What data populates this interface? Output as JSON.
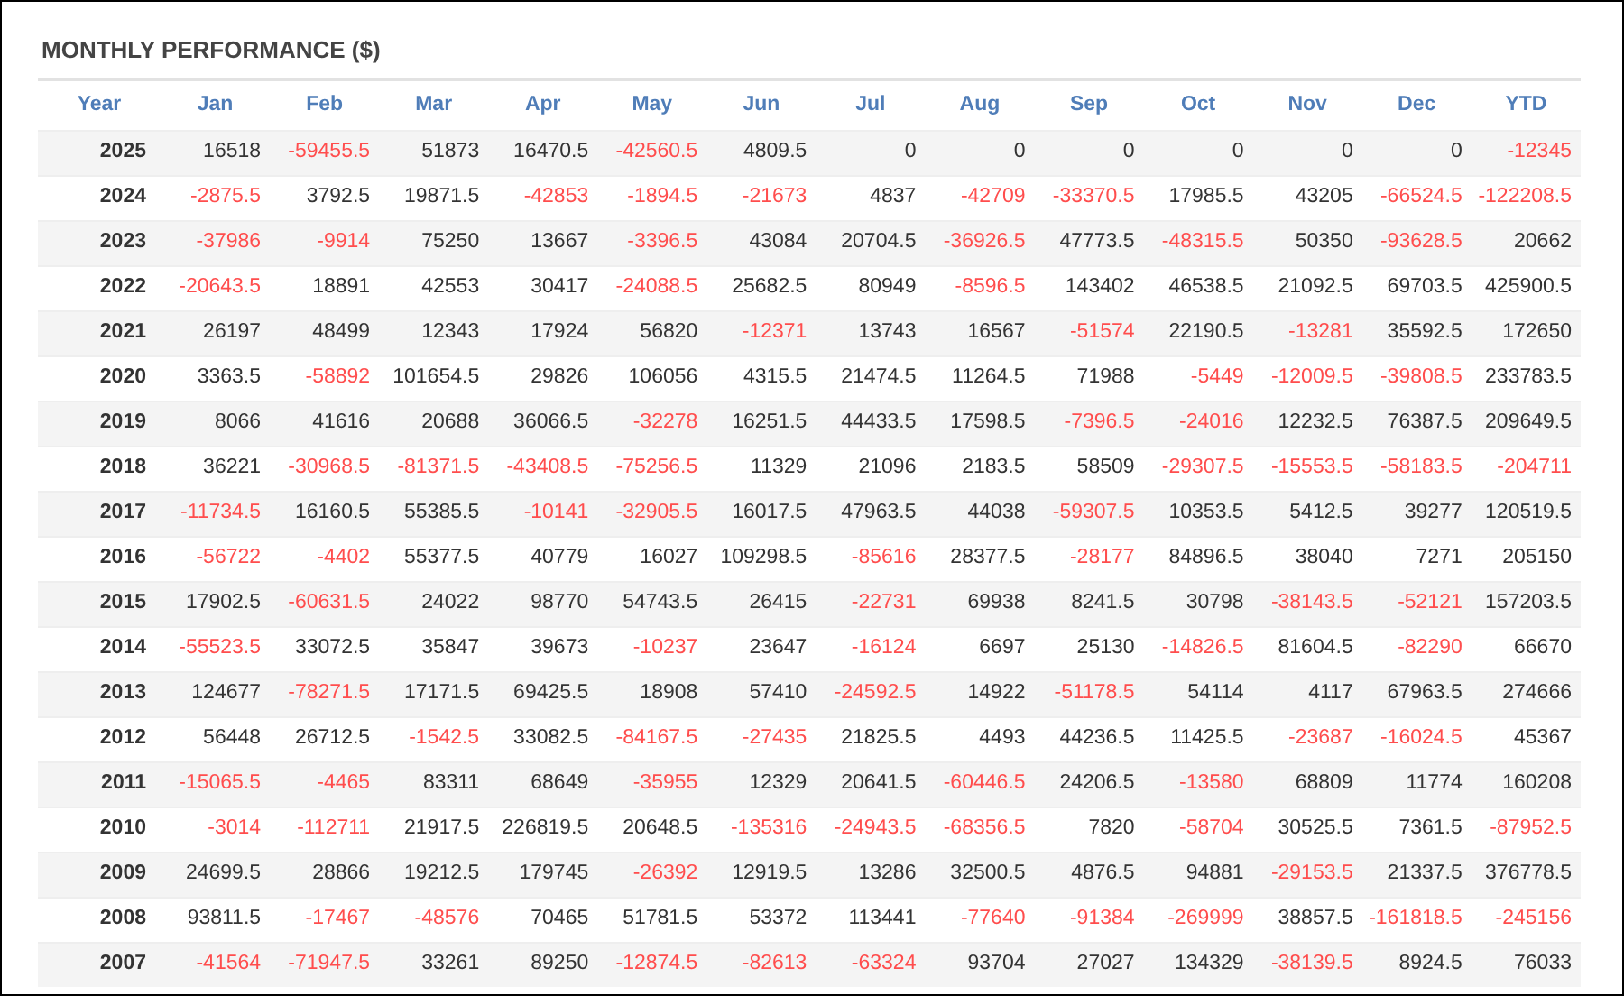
{
  "title": "MONTHLY PERFORMANCE ($)",
  "table": {
    "columns": [
      "Year",
      "Jan",
      "Feb",
      "Mar",
      "Apr",
      "May",
      "Jun",
      "Jul",
      "Aug",
      "Sep",
      "Oct",
      "Nov",
      "Dec",
      "YTD"
    ],
    "rows": [
      {
        "cells": [
          {
            "value": "2025",
            "negative": false
          },
          {
            "value": "16518",
            "negative": false
          },
          {
            "value": "-59455.5",
            "negative": true
          },
          {
            "value": "51873",
            "negative": false
          },
          {
            "value": "16470.5",
            "negative": false
          },
          {
            "value": "-42560.5",
            "negative": true
          },
          {
            "value": "4809.5",
            "negative": false
          },
          {
            "value": "0",
            "negative": false
          },
          {
            "value": "0",
            "negative": false
          },
          {
            "value": "0",
            "negative": false
          },
          {
            "value": "0",
            "negative": false
          },
          {
            "value": "0",
            "negative": false
          },
          {
            "value": "0",
            "negative": false
          },
          {
            "value": "-12345",
            "negative": true
          }
        ]
      },
      {
        "cells": [
          {
            "value": "2024",
            "negative": false
          },
          {
            "value": "-2875.5",
            "negative": true
          },
          {
            "value": "3792.5",
            "negative": false
          },
          {
            "value": "19871.5",
            "negative": false
          },
          {
            "value": "-42853",
            "negative": true
          },
          {
            "value": "-1894.5",
            "negative": true
          },
          {
            "value": "-21673",
            "negative": true
          },
          {
            "value": "4837",
            "negative": false
          },
          {
            "value": "-42709",
            "negative": true
          },
          {
            "value": "-33370.5",
            "negative": true
          },
          {
            "value": "17985.5",
            "negative": false
          },
          {
            "value": "43205",
            "negative": false
          },
          {
            "value": "-66524.5",
            "negative": true
          },
          {
            "value": "-122208.5",
            "negative": true
          }
        ]
      },
      {
        "cells": [
          {
            "value": "2023",
            "negative": false
          },
          {
            "value": "-37986",
            "negative": true
          },
          {
            "value": "-9914",
            "negative": true
          },
          {
            "value": "75250",
            "negative": false
          },
          {
            "value": "13667",
            "negative": false
          },
          {
            "value": "-3396.5",
            "negative": true
          },
          {
            "value": "43084",
            "negative": false
          },
          {
            "value": "20704.5",
            "negative": false
          },
          {
            "value": "-36926.5",
            "negative": true
          },
          {
            "value": "47773.5",
            "negative": false
          },
          {
            "value": "-48315.5",
            "negative": true
          },
          {
            "value": "50350",
            "negative": false
          },
          {
            "value": "-93628.5",
            "negative": true
          },
          {
            "value": "20662",
            "negative": false
          }
        ]
      },
      {
        "cells": [
          {
            "value": "2022",
            "negative": false
          },
          {
            "value": "-20643.5",
            "negative": true
          },
          {
            "value": "18891",
            "negative": false
          },
          {
            "value": "42553",
            "negative": false
          },
          {
            "value": "30417",
            "negative": false
          },
          {
            "value": "-24088.5",
            "negative": true
          },
          {
            "value": "25682.5",
            "negative": false
          },
          {
            "value": "80949",
            "negative": false
          },
          {
            "value": "-8596.5",
            "negative": true
          },
          {
            "value": "143402",
            "negative": false
          },
          {
            "value": "46538.5",
            "negative": false
          },
          {
            "value": "21092.5",
            "negative": false
          },
          {
            "value": "69703.5",
            "negative": false
          },
          {
            "value": "425900.5",
            "negative": false
          }
        ]
      },
      {
        "cells": [
          {
            "value": "2021",
            "negative": false
          },
          {
            "value": "26197",
            "negative": false
          },
          {
            "value": "48499",
            "negative": false
          },
          {
            "value": "12343",
            "negative": false
          },
          {
            "value": "17924",
            "negative": false
          },
          {
            "value": "56820",
            "negative": false
          },
          {
            "value": "-12371",
            "negative": true
          },
          {
            "value": "13743",
            "negative": false
          },
          {
            "value": "16567",
            "negative": false
          },
          {
            "value": "-51574",
            "negative": true
          },
          {
            "value": "22190.5",
            "negative": false
          },
          {
            "value": "-13281",
            "negative": true
          },
          {
            "value": "35592.5",
            "negative": false
          },
          {
            "value": "172650",
            "negative": false
          }
        ]
      },
      {
        "cells": [
          {
            "value": "2020",
            "negative": false
          },
          {
            "value": "3363.5",
            "negative": false
          },
          {
            "value": "-58892",
            "negative": true
          },
          {
            "value": "101654.5",
            "negative": false
          },
          {
            "value": "29826",
            "negative": false
          },
          {
            "value": "106056",
            "negative": false
          },
          {
            "value": "4315.5",
            "negative": false
          },
          {
            "value": "21474.5",
            "negative": false
          },
          {
            "value": "11264.5",
            "negative": false
          },
          {
            "value": "71988",
            "negative": false
          },
          {
            "value": "-5449",
            "negative": true
          },
          {
            "value": "-12009.5",
            "negative": true
          },
          {
            "value": "-39808.5",
            "negative": true
          },
          {
            "value": "233783.5",
            "negative": false
          }
        ]
      },
      {
        "cells": [
          {
            "value": "2019",
            "negative": false
          },
          {
            "value": "8066",
            "negative": false
          },
          {
            "value": "41616",
            "negative": false
          },
          {
            "value": "20688",
            "negative": false
          },
          {
            "value": "36066.5",
            "negative": false
          },
          {
            "value": "-32278",
            "negative": true
          },
          {
            "value": "16251.5",
            "negative": false
          },
          {
            "value": "44433.5",
            "negative": false
          },
          {
            "value": "17598.5",
            "negative": false
          },
          {
            "value": "-7396.5",
            "negative": true
          },
          {
            "value": "-24016",
            "negative": true
          },
          {
            "value": "12232.5",
            "negative": false
          },
          {
            "value": "76387.5",
            "negative": false
          },
          {
            "value": "209649.5",
            "negative": false
          }
        ]
      },
      {
        "cells": [
          {
            "value": "2018",
            "negative": false
          },
          {
            "value": "36221",
            "negative": false
          },
          {
            "value": "-30968.5",
            "negative": true
          },
          {
            "value": "-81371.5",
            "negative": true
          },
          {
            "value": "-43408.5",
            "negative": true
          },
          {
            "value": "-75256.5",
            "negative": true
          },
          {
            "value": "11329",
            "negative": false
          },
          {
            "value": "21096",
            "negative": false
          },
          {
            "value": "2183.5",
            "negative": false
          },
          {
            "value": "58509",
            "negative": false
          },
          {
            "value": "-29307.5",
            "negative": true
          },
          {
            "value": "-15553.5",
            "negative": true
          },
          {
            "value": "-58183.5",
            "negative": true
          },
          {
            "value": "-204711",
            "negative": true
          }
        ]
      },
      {
        "cells": [
          {
            "value": "2017",
            "negative": false
          },
          {
            "value": "-11734.5",
            "negative": true
          },
          {
            "value": "16160.5",
            "negative": false
          },
          {
            "value": "55385.5",
            "negative": false
          },
          {
            "value": "-10141",
            "negative": true
          },
          {
            "value": "-32905.5",
            "negative": true
          },
          {
            "value": "16017.5",
            "negative": false
          },
          {
            "value": "47963.5",
            "negative": false
          },
          {
            "value": "44038",
            "negative": false
          },
          {
            "value": "-59307.5",
            "negative": true
          },
          {
            "value": "10353.5",
            "negative": false
          },
          {
            "value": "5412.5",
            "negative": false
          },
          {
            "value": "39277",
            "negative": false
          },
          {
            "value": "120519.5",
            "negative": false
          }
        ]
      },
      {
        "cells": [
          {
            "value": "2016",
            "negative": false
          },
          {
            "value": "-56722",
            "negative": true
          },
          {
            "value": "-4402",
            "negative": true
          },
          {
            "value": "55377.5",
            "negative": false
          },
          {
            "value": "40779",
            "negative": false
          },
          {
            "value": "16027",
            "negative": false
          },
          {
            "value": "109298.5",
            "negative": false
          },
          {
            "value": "-85616",
            "negative": true
          },
          {
            "value": "28377.5",
            "negative": false
          },
          {
            "value": "-28177",
            "negative": true
          },
          {
            "value": "84896.5",
            "negative": false
          },
          {
            "value": "38040",
            "negative": false
          },
          {
            "value": "7271",
            "negative": false
          },
          {
            "value": "205150",
            "negative": false
          }
        ]
      },
      {
        "cells": [
          {
            "value": "2015",
            "negative": false
          },
          {
            "value": "17902.5",
            "negative": false
          },
          {
            "value": "-60631.5",
            "negative": true
          },
          {
            "value": "24022",
            "negative": false
          },
          {
            "value": "98770",
            "negative": false
          },
          {
            "value": "54743.5",
            "negative": false
          },
          {
            "value": "26415",
            "negative": false
          },
          {
            "value": "-22731",
            "negative": true
          },
          {
            "value": "69938",
            "negative": false
          },
          {
            "value": "8241.5",
            "negative": false
          },
          {
            "value": "30798",
            "negative": false
          },
          {
            "value": "-38143.5",
            "negative": true
          },
          {
            "value": "-52121",
            "negative": true
          },
          {
            "value": "157203.5",
            "negative": false
          }
        ]
      },
      {
        "cells": [
          {
            "value": "2014",
            "negative": false
          },
          {
            "value": "-55523.5",
            "negative": true
          },
          {
            "value": "33072.5",
            "negative": false
          },
          {
            "value": "35847",
            "negative": false
          },
          {
            "value": "39673",
            "negative": false
          },
          {
            "value": "-10237",
            "negative": true
          },
          {
            "value": "23647",
            "negative": false
          },
          {
            "value": "-16124",
            "negative": true
          },
          {
            "value": "6697",
            "negative": false
          },
          {
            "value": "25130",
            "negative": false
          },
          {
            "value": "-14826.5",
            "negative": true
          },
          {
            "value": "81604.5",
            "negative": false
          },
          {
            "value": "-82290",
            "negative": true
          },
          {
            "value": "66670",
            "negative": false
          }
        ]
      },
      {
        "cells": [
          {
            "value": "2013",
            "negative": false
          },
          {
            "value": "124677",
            "negative": false
          },
          {
            "value": "-78271.5",
            "negative": true
          },
          {
            "value": "17171.5",
            "negative": false
          },
          {
            "value": "69425.5",
            "negative": false
          },
          {
            "value": "18908",
            "negative": false
          },
          {
            "value": "57410",
            "negative": false
          },
          {
            "value": "-24592.5",
            "negative": true
          },
          {
            "value": "14922",
            "negative": false
          },
          {
            "value": "-51178.5",
            "negative": true
          },
          {
            "value": "54114",
            "negative": false
          },
          {
            "value": "4117",
            "negative": false
          },
          {
            "value": "67963.5",
            "negative": false
          },
          {
            "value": "274666",
            "negative": false
          }
        ]
      },
      {
        "cells": [
          {
            "value": "2012",
            "negative": false
          },
          {
            "value": "56448",
            "negative": false
          },
          {
            "value": "26712.5",
            "negative": false
          },
          {
            "value": "-1542.5",
            "negative": true
          },
          {
            "value": "33082.5",
            "negative": false
          },
          {
            "value": "-84167.5",
            "negative": true
          },
          {
            "value": "-27435",
            "negative": true
          },
          {
            "value": "21825.5",
            "negative": false
          },
          {
            "value": "4493",
            "negative": false
          },
          {
            "value": "44236.5",
            "negative": false
          },
          {
            "value": "11425.5",
            "negative": false
          },
          {
            "value": "-23687",
            "negative": true
          },
          {
            "value": "-16024.5",
            "negative": true
          },
          {
            "value": "45367",
            "negative": false
          }
        ]
      },
      {
        "cells": [
          {
            "value": "2011",
            "negative": false
          },
          {
            "value": "-15065.5",
            "negative": true
          },
          {
            "value": "-4465",
            "negative": true
          },
          {
            "value": "83311",
            "negative": false
          },
          {
            "value": "68649",
            "negative": false
          },
          {
            "value": "-35955",
            "negative": true
          },
          {
            "value": "12329",
            "negative": false
          },
          {
            "value": "20641.5",
            "negative": false
          },
          {
            "value": "-60446.5",
            "negative": true
          },
          {
            "value": "24206.5",
            "negative": false
          },
          {
            "value": "-13580",
            "negative": true
          },
          {
            "value": "68809",
            "negative": false
          },
          {
            "value": "11774",
            "negative": false
          },
          {
            "value": "160208",
            "negative": false
          }
        ]
      },
      {
        "cells": [
          {
            "value": "2010",
            "negative": false
          },
          {
            "value": "-3014",
            "negative": true
          },
          {
            "value": "-112711",
            "negative": true
          },
          {
            "value": "21917.5",
            "negative": false
          },
          {
            "value": "226819.5",
            "negative": false
          },
          {
            "value": "20648.5",
            "negative": false
          },
          {
            "value": "-135316",
            "negative": true
          },
          {
            "value": "-24943.5",
            "negative": true
          },
          {
            "value": "-68356.5",
            "negative": true
          },
          {
            "value": "7820",
            "negative": false
          },
          {
            "value": "-58704",
            "negative": true
          },
          {
            "value": "30525.5",
            "negative": false
          },
          {
            "value": "7361.5",
            "negative": false
          },
          {
            "value": "-87952.5",
            "negative": true
          }
        ]
      },
      {
        "cells": [
          {
            "value": "2009",
            "negative": false
          },
          {
            "value": "24699.5",
            "negative": false
          },
          {
            "value": "28866",
            "negative": false
          },
          {
            "value": "19212.5",
            "negative": false
          },
          {
            "value": "179745",
            "negative": false
          },
          {
            "value": "-26392",
            "negative": true
          },
          {
            "value": "12919.5",
            "negative": false
          },
          {
            "value": "13286",
            "negative": false
          },
          {
            "value": "32500.5",
            "negative": false
          },
          {
            "value": "4876.5",
            "negative": false
          },
          {
            "value": "94881",
            "negative": false
          },
          {
            "value": "-29153.5",
            "negative": true
          },
          {
            "value": "21337.5",
            "negative": false
          },
          {
            "value": "376778.5",
            "negative": false
          }
        ]
      },
      {
        "cells": [
          {
            "value": "2008",
            "negative": false
          },
          {
            "value": "93811.5",
            "negative": false
          },
          {
            "value": "-17467",
            "negative": true
          },
          {
            "value": "-48576",
            "negative": true
          },
          {
            "value": "70465",
            "negative": false
          },
          {
            "value": "51781.5",
            "negative": false
          },
          {
            "value": "53372",
            "negative": false
          },
          {
            "value": "113441",
            "negative": false
          },
          {
            "value": "-77640",
            "negative": true
          },
          {
            "value": "-91384",
            "negative": true
          },
          {
            "value": "-269999",
            "negative": true
          },
          {
            "value": "38857.5",
            "negative": false
          },
          {
            "value": "-161818.5",
            "negative": true
          },
          {
            "value": "-245156",
            "negative": true
          }
        ]
      },
      {
        "cells": [
          {
            "value": "2007",
            "negative": false
          },
          {
            "value": "-41564",
            "negative": true
          },
          {
            "value": "-71947.5",
            "negative": true
          },
          {
            "value": "33261",
            "negative": false
          },
          {
            "value": "89250",
            "negative": false
          },
          {
            "value": "-12874.5",
            "negative": true
          },
          {
            "value": "-82613",
            "negative": true
          },
          {
            "value": "-63324",
            "negative": true
          },
          {
            "value": "93704",
            "negative": false
          },
          {
            "value": "27027",
            "negative": false
          },
          {
            "value": "134329",
            "negative": false
          },
          {
            "value": "-38139.5",
            "negative": true
          },
          {
            "value": "8924.5",
            "negative": false
          },
          {
            "value": "76033",
            "negative": false
          }
        ]
      }
    ]
  }
}
